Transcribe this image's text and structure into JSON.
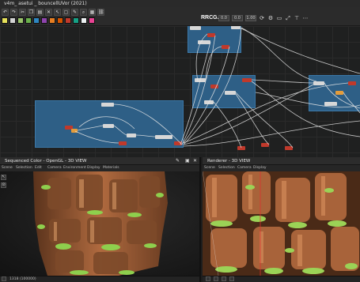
{
  "app": {
    "title": "v4m_ asetui _ bouncellUVor (2021)"
  },
  "toolbar": {
    "watermark": "RRCG.cn",
    "right_fields": [
      "0.0",
      "0.0",
      "1.00"
    ],
    "row1_icons": [
      "undo-icon",
      "redo-icon",
      "cut-icon",
      "copy-icon",
      "paste-icon",
      "delete-icon",
      "cursor-icon",
      "frame-icon",
      "comment-icon",
      "zoom-icon",
      "grid-icon",
      "link-icon"
    ],
    "row2_swatches": [
      "#e6e05a",
      "#d4d4d4",
      "#9ac46b",
      "#6ab04c",
      "#2e86c1",
      "#8e44ad",
      "#e67e22",
      "#d35400",
      "#c0392b",
      "#16a085",
      "#ecf0f1",
      "#e84393"
    ]
  },
  "left_panel": {
    "title": "Sequenced Color - OpenGL - 3D VIEW",
    "menu": [
      "Scene",
      "Selection",
      "Edit",
      "Camera",
      "Environment",
      "Display",
      "Materials"
    ],
    "status": "1318 (100000)",
    "side_tools": [
      "arrow-tool-icon",
      "pin-tool-icon"
    ]
  },
  "right_panel": {
    "title": "Renderer - 3D VIEW",
    "menu": [
      "Scene",
      "Selection",
      "Camera",
      "Display"
    ]
  }
}
